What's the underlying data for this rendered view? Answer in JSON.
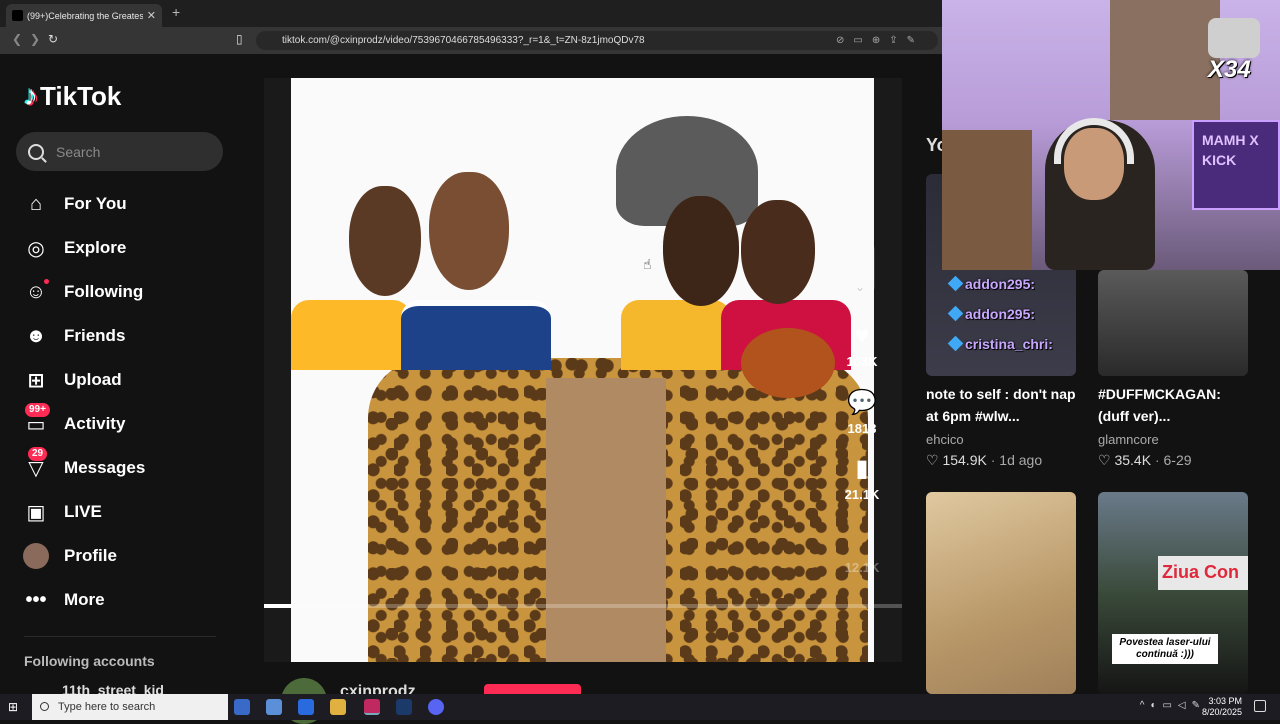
{
  "browser": {
    "tab_title": "(99+)Celebrating the Greatest",
    "url": "tiktok.com/@cxinprodz/video/7539670466785496333?_r=1&_t=ZN-8z1jmoQDv78"
  },
  "sidebar": {
    "logo": "TikTok",
    "search_placeholder": "Search",
    "items": [
      {
        "label": "For You",
        "icon": "home-icon"
      },
      {
        "label": "Explore",
        "icon": "compass-icon"
      },
      {
        "label": "Following",
        "icon": "following-icon"
      },
      {
        "label": "Friends",
        "icon": "friends-icon"
      },
      {
        "label": "Upload",
        "icon": "plus-square-icon"
      },
      {
        "label": "Activity",
        "icon": "inbox-icon",
        "badge": "99+"
      },
      {
        "label": "Messages",
        "icon": "send-icon",
        "badge": "29"
      },
      {
        "label": "LIVE",
        "icon": "tv-icon"
      },
      {
        "label": "Profile",
        "icon": "avatar"
      },
      {
        "label": "More",
        "icon": "ellipsis-icon"
      }
    ],
    "following_title": "Following accounts",
    "following_first": "11th_street_kid"
  },
  "video": {
    "likes": "108K",
    "comments": "1813",
    "saves": "21.1K",
    "shares": "12.1K",
    "author": "cxinprodz"
  },
  "right_column": {
    "section_label": "Yo",
    "cards": [
      {
        "title": "note to self : don't nap at 6pm #wlw...",
        "author": "ehcico",
        "likes": "154.9K",
        "date": "1d ago"
      },
      {
        "title": "#DUFFMCKAGAN: (duff ver)...",
        "author": "glamncore",
        "likes": "35.4K",
        "date": "6-29"
      },
      {
        "caption": ""
      },
      {
        "caption": "Povestea laser-ului continuă :)))",
        "banner": "Ziua Con"
      }
    ]
  },
  "stream_overlay": {
    "gift_counter": "X34",
    "neon_sign": "MAMH X KICK",
    "chat": [
      {
        "user": "addon295:"
      },
      {
        "user": "addon295:"
      },
      {
        "user": "cristina_chri:"
      }
    ]
  },
  "taskbar": {
    "search_placeholder": "Type here to search",
    "time": "3:03 PM",
    "date": "8/20/2025"
  }
}
